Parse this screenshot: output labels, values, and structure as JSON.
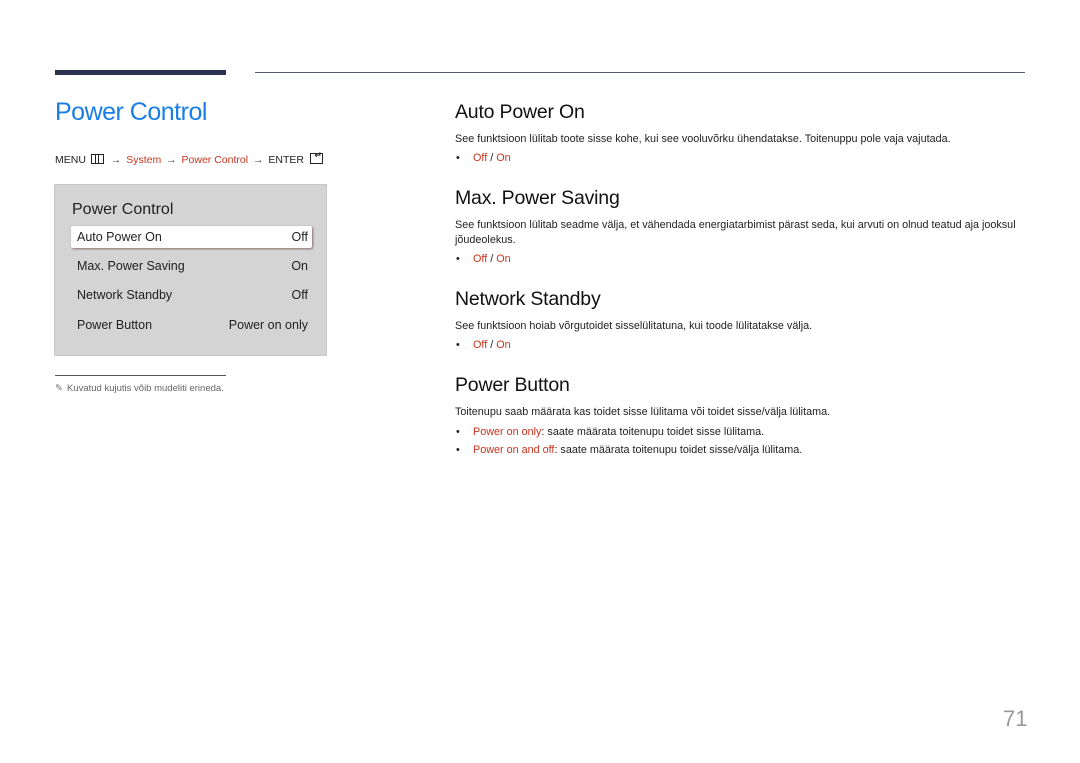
{
  "page": {
    "title": "Power Control",
    "page_number": "71"
  },
  "breadcrumb": {
    "menu": "MENU",
    "menu_icon": "menu-grid-icon",
    "arrow": "→",
    "system": "System",
    "power_control": "Power Control",
    "enter": "ENTER",
    "enter_icon": "enter-icon"
  },
  "menu_panel": {
    "title": "Power Control",
    "items": [
      {
        "label": "Auto Power On",
        "value": "Off",
        "selected": true
      },
      {
        "label": "Max. Power Saving",
        "value": "On",
        "selected": false
      },
      {
        "label": "Network Standby",
        "value": "Off",
        "selected": false
      },
      {
        "label": "Power Button",
        "value": "Power on only",
        "selected": false
      }
    ]
  },
  "note": {
    "icon": "pencil-icon",
    "text": "Kuvatud kujutis võib mudeliti erineda."
  },
  "sections": [
    {
      "heading": "Auto Power On",
      "description": "See funktsioon lülitab toote sisse kohe, kui see vooluvõrku ühendatakse. Toitenuppu pole vaja vajutada.",
      "options": {
        "a": "Off",
        "sep": " / ",
        "b": "On"
      }
    },
    {
      "heading": "Max. Power Saving",
      "description": "See funktsioon lülitab seadme välja, et vähendada energiatarbimist pärast seda, kui arvuti on olnud teatud aja jooksul jõudeolekus.",
      "options": {
        "a": "Off",
        "sep": " / ",
        "b": "On"
      }
    },
    {
      "heading": "Network Standby",
      "description": "See funktsioon hoiab võrgutoidet sisselülitatuna, kui toode lülitatakse välja.",
      "options": {
        "a": "Off",
        "sep": " / ",
        "b": "On"
      }
    },
    {
      "heading": "Power Button",
      "description": "Toitenupu saab määrata kas toidet sisse lülitama või toidet sisse/välja lülitama.",
      "bullets": [
        {
          "term": "Power on only",
          "text": ": saate määrata toitenupu toidet sisse lülitama."
        },
        {
          "term": "Power on and off",
          "text": ": saate määrata toitenupu toidet sisse/välja lülitama."
        }
      ]
    }
  ],
  "colors": {
    "title_blue": "#1a7ee6",
    "highlight_red": "#c8341c",
    "panel_gray": "#d4d4d4",
    "bar_navy": "#2b3150"
  }
}
